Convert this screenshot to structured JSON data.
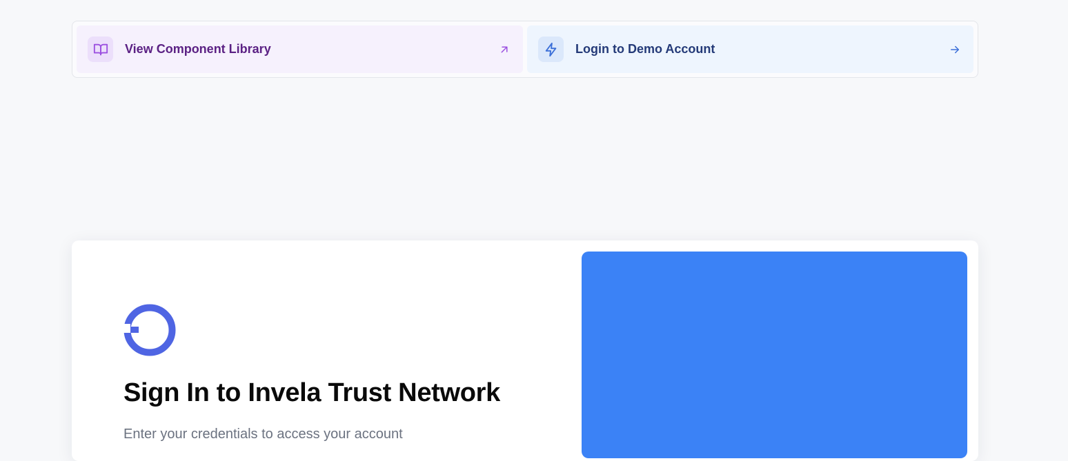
{
  "quick_links": {
    "component_library": {
      "label": "View Component Library",
      "icon": "book-open-icon",
      "arrow_icon": "arrow-up-right-icon",
      "accent": "#9b4fe0"
    },
    "demo_login": {
      "label": "Login to Demo Account",
      "icon": "lightning-bolt-icon",
      "arrow_icon": "arrow-right-icon",
      "accent": "#3b6fd8"
    }
  },
  "login": {
    "logo_icon": "invela-logo-icon",
    "brand_color": "#4f65e3",
    "heading": "Sign In to Invela Trust Network",
    "subtext": "Enter your credentials to access your account",
    "hero_color": "#3b82f6"
  }
}
